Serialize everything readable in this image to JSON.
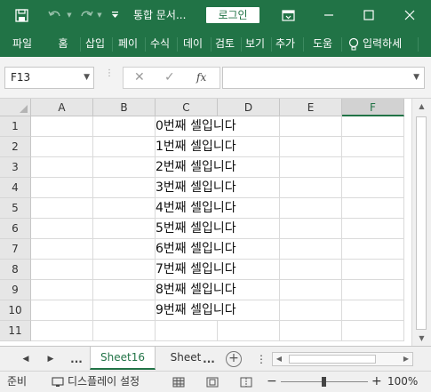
{
  "titlebar": {
    "title": "통합 문서...",
    "login_label": "로그인",
    "icons": [
      "save-icon",
      "undo-icon",
      "redo-icon",
      "customize-icon",
      "ribbon-display-icon",
      "minimize-icon",
      "maximize-icon",
      "close-icon"
    ]
  },
  "ribbon": {
    "tabs": [
      "파일",
      "홈",
      "삽입",
      "페이",
      "수식",
      "데이",
      "검토",
      "보기",
      "추가",
      "도움",
      "입력하세"
    ]
  },
  "formula_bar": {
    "name_box": "F13",
    "cancel_symbol": "✕",
    "enter_symbol": "✓",
    "fx_symbol": "fx",
    "value": ""
  },
  "grid": {
    "columns": [
      "A",
      "B",
      "C",
      "D",
      "E",
      "F"
    ],
    "selected_column": "F",
    "rows": [
      "1",
      "2",
      "3",
      "4",
      "5",
      "6",
      "7",
      "8",
      "9",
      "10",
      "11"
    ],
    "cells_c": [
      "0번째 셀입니다",
      "1번째 셀입니다",
      "2번째 셀입니다",
      "3번째 셀입니다",
      "4번째 셀입니다",
      "5번째 셀입니다",
      "6번째 셀입니다",
      "7번째 셀입니다",
      "8번째 셀입니다",
      "9번째 셀입니다",
      ""
    ]
  },
  "sheets": {
    "ellipsis_left": "...",
    "active": "Sheet16",
    "other": "Sheet",
    "ellipsis_right": "...",
    "add_label": "+"
  },
  "statusbar": {
    "ready": "준비",
    "display_settings": "디스플레이 설정",
    "zoom_minus": "−",
    "zoom_plus": "+",
    "zoom": "100%"
  },
  "colors": {
    "accent": "#217346"
  }
}
